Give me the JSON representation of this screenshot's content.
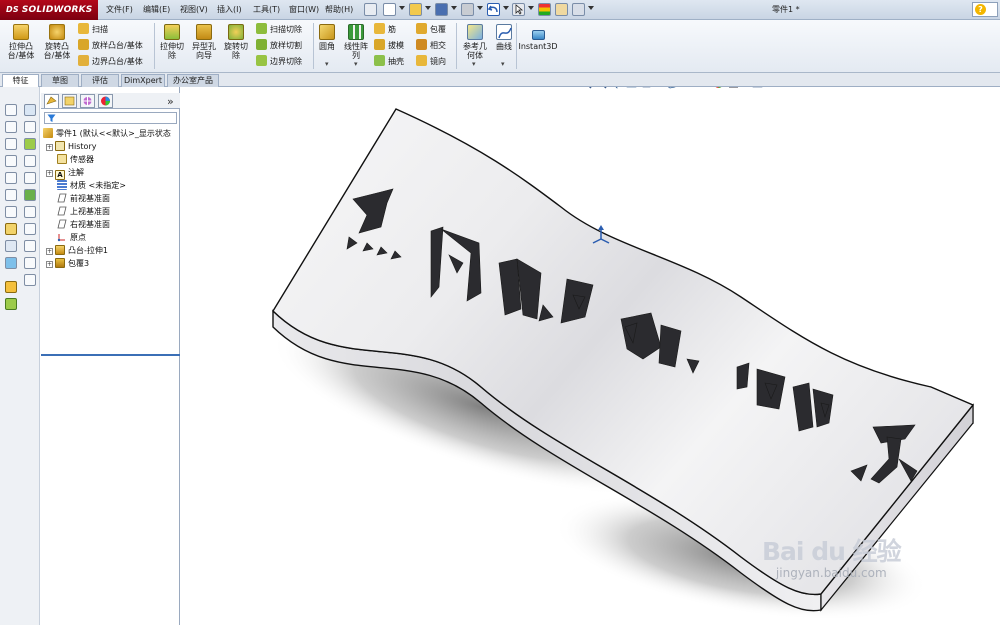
{
  "app": {
    "logo_prefix": "DS",
    "logo_text": "SOLIDWORKS",
    "document_title": "零件1 *"
  },
  "menu": [
    "文件(F)",
    "编辑(E)",
    "视图(V)",
    "插入(I)",
    "工具(T)",
    "窗口(W)",
    "帮助(H)"
  ],
  "ribbon": {
    "extrude_boss": "拉伸凸\n台/基体",
    "revolve_boss": "旋转凸\n台/基体",
    "sweep": "扫描",
    "loft_boss": "放样凸台/基体",
    "boundary_boss": "边界凸台/基体",
    "extrude_cut": "拉伸切\n除",
    "hole_wizard": "异型孔\n向导",
    "revolve_cut": "旋转切\n除",
    "sweep_cut": "扫描切除",
    "loft_cut": "放样切割",
    "boundary_cut": "边界切除",
    "fillet": "圆角",
    "linear_pattern": "线性阵\n列",
    "rib": "筋",
    "draft": "拔模",
    "shell": "抽壳",
    "wrap": "包覆",
    "intersect": "相交",
    "mirror": "镜向",
    "reference_geometry": "参考几\n何体",
    "curves": "曲线",
    "instant3d": "Instant3D"
  },
  "tabs": [
    "特征",
    "草图",
    "评估",
    "DimXpert",
    "办公室产品"
  ],
  "feature_tree": {
    "root": "零件1  (默认<<默认>_显示状态",
    "items": [
      {
        "label": "History",
        "expandable": true,
        "icon": "history-icon"
      },
      {
        "label": "传感器",
        "expandable": false,
        "icon": "sensor-icon"
      },
      {
        "label": "注解",
        "expandable": true,
        "icon": "annotation-icon"
      },
      {
        "label": "材质 <未指定>",
        "expandable": false,
        "icon": "material-icon"
      },
      {
        "label": "前视基准面",
        "expandable": false,
        "icon": "plane-icon"
      },
      {
        "label": "上视基准面",
        "expandable": false,
        "icon": "plane-icon"
      },
      {
        "label": "右视基准面",
        "expandable": false,
        "icon": "plane-icon"
      },
      {
        "label": "原点",
        "expandable": false,
        "icon": "origin-icon"
      },
      {
        "label": "凸台-拉伸1",
        "expandable": true,
        "icon": "extrude-icon"
      },
      {
        "label": "包覆3",
        "expandable": true,
        "icon": "wrap-icon"
      }
    ]
  },
  "model": {
    "engraved_text": "热风吹得酒醉人"
  },
  "watermark": {
    "brand": "Bai du 经验",
    "url": "jingyan.baidu.com"
  },
  "colors": {
    "brand_red": "#a8061a",
    "ribbon_bg": "#eef2f7",
    "tree_selection": "#3b6fb6"
  }
}
